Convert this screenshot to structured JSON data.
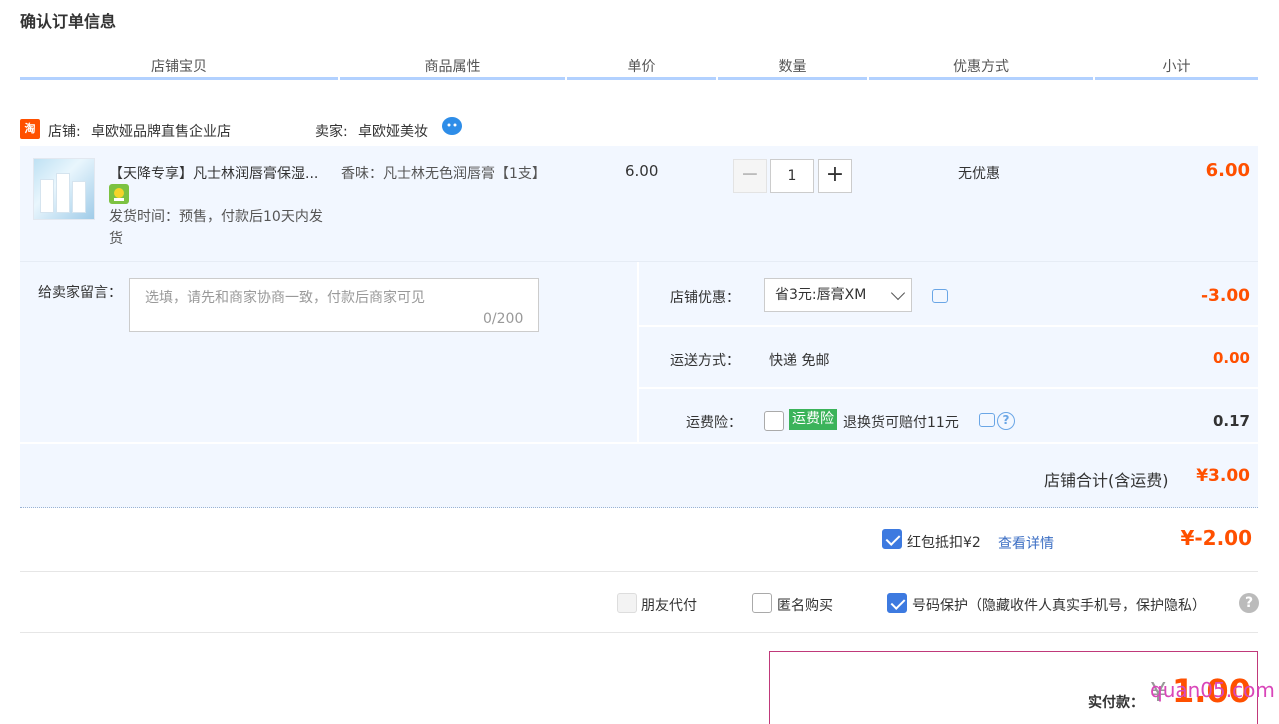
{
  "page": {
    "title": "确认订单信息"
  },
  "columns": [
    "店铺宝贝",
    "商品属性",
    "单价",
    "数量",
    "优惠方式",
    "小计"
  ],
  "shop": {
    "icon_text": "淘",
    "shop_label": "店铺:",
    "shop_name": "卓欧娅品牌直售企业店",
    "seller_label": "卖家:",
    "seller_name": "卓欧娅美妆"
  },
  "item": {
    "title": "【天降专享】凡士林润唇膏保湿...",
    "ship_time": "发货时间：预售，付款后10天内发货",
    "attribute": "香味：凡士林无色润唇膏【1支】",
    "unit_price": "6.00",
    "quantity": "1",
    "minus": "−",
    "plus": "+",
    "discount": "无优惠",
    "subtotal": "6.00"
  },
  "message": {
    "label": "给卖家留言：",
    "placeholder": "选填，请先和商家协商一致，付款后商家可见",
    "counter": "0/200"
  },
  "shop_discount": {
    "label": "店铺优惠：",
    "selected": "省3元:唇膏XM",
    "amount": "-3.00"
  },
  "shipping": {
    "label": "运送方式：",
    "value": "快递 免邮",
    "amount": "0.00"
  },
  "insurance": {
    "label": "运费险：",
    "badge": "运费险",
    "text": "退换货可赔付11元",
    "help": "?",
    "amount": "0.17"
  },
  "shop_total": {
    "label": "店铺合计(含运费)",
    "amount": "¥3.00"
  },
  "red_packet": {
    "text": "红包抵扣¥2",
    "link": "查看详情",
    "amount": "¥-2.00"
  },
  "options": {
    "friend_pay": "朋友代付",
    "anonymous": "匿名购买",
    "number_protect": "号码保护（隐藏收件人真实手机号，保护隐私）",
    "help": "?"
  },
  "payment": {
    "label": "实付款：",
    "currency": "¥",
    "amount": "1.00"
  },
  "watermark": "quan05.com",
  "colors": {
    "accent": "#ff5000",
    "blue": "#3d7ae0",
    "panel_bg": "#f2f7ff"
  }
}
